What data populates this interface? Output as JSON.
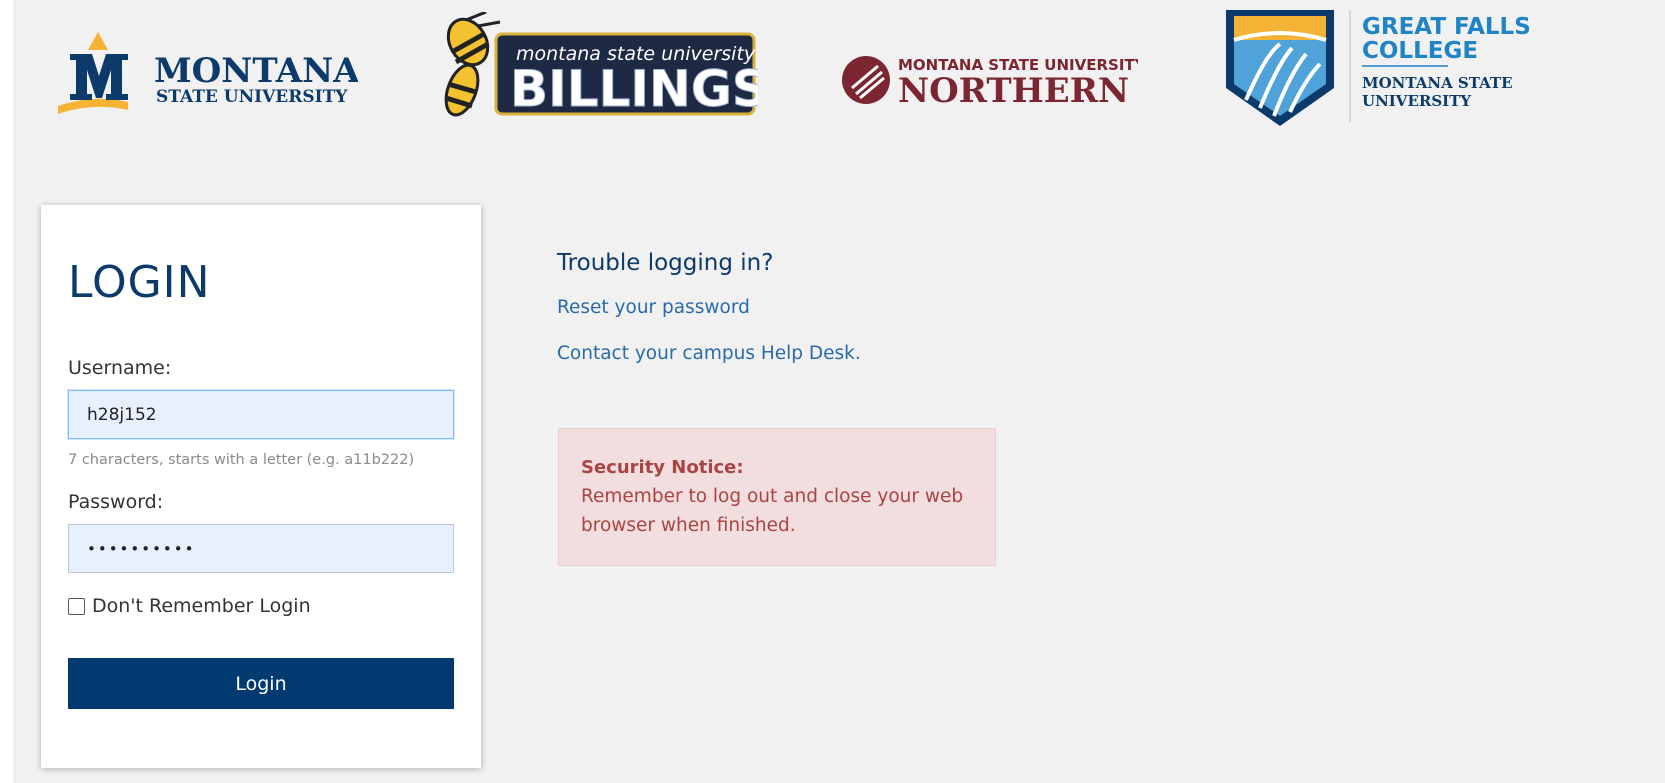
{
  "logos": {
    "msu": {
      "line1": "MONTANA",
      "line2": "STATE UNIVERSITY",
      "mark": "M"
    },
    "billings": {
      "line1": "montana state university",
      "line2": "BILLINGS"
    },
    "northern": {
      "line1": "MONTANA STATE UNIVERSITY",
      "line2": "NORTHERN"
    },
    "gfc": {
      "line1": "GREAT FALLS",
      "line2": "COLLEGE",
      "line3": "MONTANA STATE",
      "line4": "UNIVERSITY"
    }
  },
  "login": {
    "title": "LOGIN",
    "username_label": "Username:",
    "username_value": "h28j152",
    "username_hint": "7 characters, starts with a letter (e.g. a11b222)",
    "password_label": "Password:",
    "password_value": "••••••••••",
    "remember_label": "Don't Remember Login",
    "remember_checked": false,
    "submit_label": "Login"
  },
  "help": {
    "title": "Trouble logging in?",
    "reset_link": "Reset your password",
    "helpdesk_link": "Contact your campus Help Desk."
  },
  "notice": {
    "title": "Security Notice:",
    "body": "Remember to log out and close your web browser when finished."
  },
  "colors": {
    "background": "#f1f1f1",
    "primary_navy": "#003a70",
    "link_blue": "#2a6aa8",
    "msu_gold": "#f5b335",
    "northern_maroon": "#7b2631",
    "notice_bg": "#f2dede",
    "notice_text": "#a94442"
  }
}
